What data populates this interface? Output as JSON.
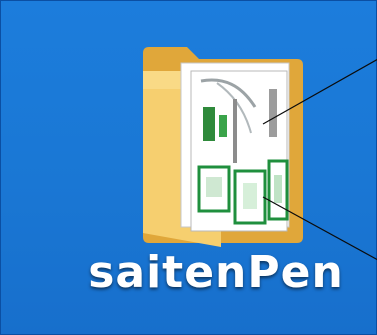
{
  "desktop": {
    "background_color": "#1a79d6",
    "icon": {
      "name": "saitenPen",
      "icon_type": "folder-icon"
    }
  }
}
